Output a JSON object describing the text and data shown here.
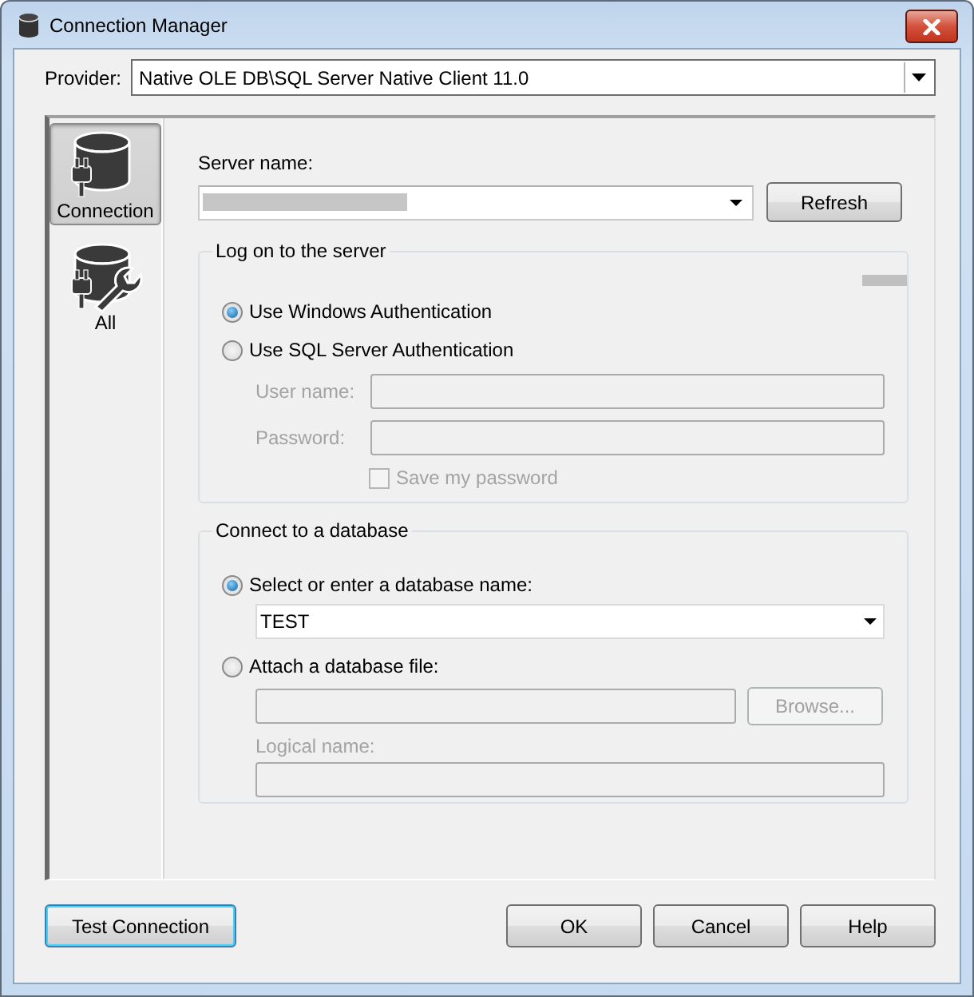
{
  "window": {
    "title": "Connection Manager"
  },
  "provider": {
    "label": "Provider:",
    "value": "Native OLE DB\\SQL Server Native Client 11.0"
  },
  "sidebar": {
    "items": [
      {
        "label": "Connection",
        "kind": "connection",
        "selected": true
      },
      {
        "label": "All",
        "kind": "all",
        "selected": false
      }
    ]
  },
  "server": {
    "label": "Server name:",
    "refresh_button": "Refresh"
  },
  "logon": {
    "title": "Log on to the server",
    "options": [
      {
        "label": "Use Windows Authentication",
        "selected": true
      },
      {
        "label": "Use SQL Server Authentication",
        "selected": false
      }
    ],
    "fields": [
      {
        "label": "User name:",
        "disabled": true
      },
      {
        "label": "Password:",
        "disabled": true
      }
    ],
    "save_password": {
      "label": "Save my password",
      "checked": false,
      "disabled": true
    }
  },
  "database": {
    "title": "Connect to a database",
    "options": [
      {
        "label": "Select or enter a database name:",
        "selected": true
      },
      {
        "label": "Attach a database file:",
        "selected": false
      }
    ],
    "database_name": "TEST",
    "browse_button": {
      "label": "Browse...",
      "disabled": true
    },
    "logical_name": {
      "label": "Logical name:",
      "disabled": true
    }
  },
  "buttons": {
    "test": "Test Connection",
    "ok": "OK",
    "cancel": "Cancel",
    "help": "Help"
  }
}
